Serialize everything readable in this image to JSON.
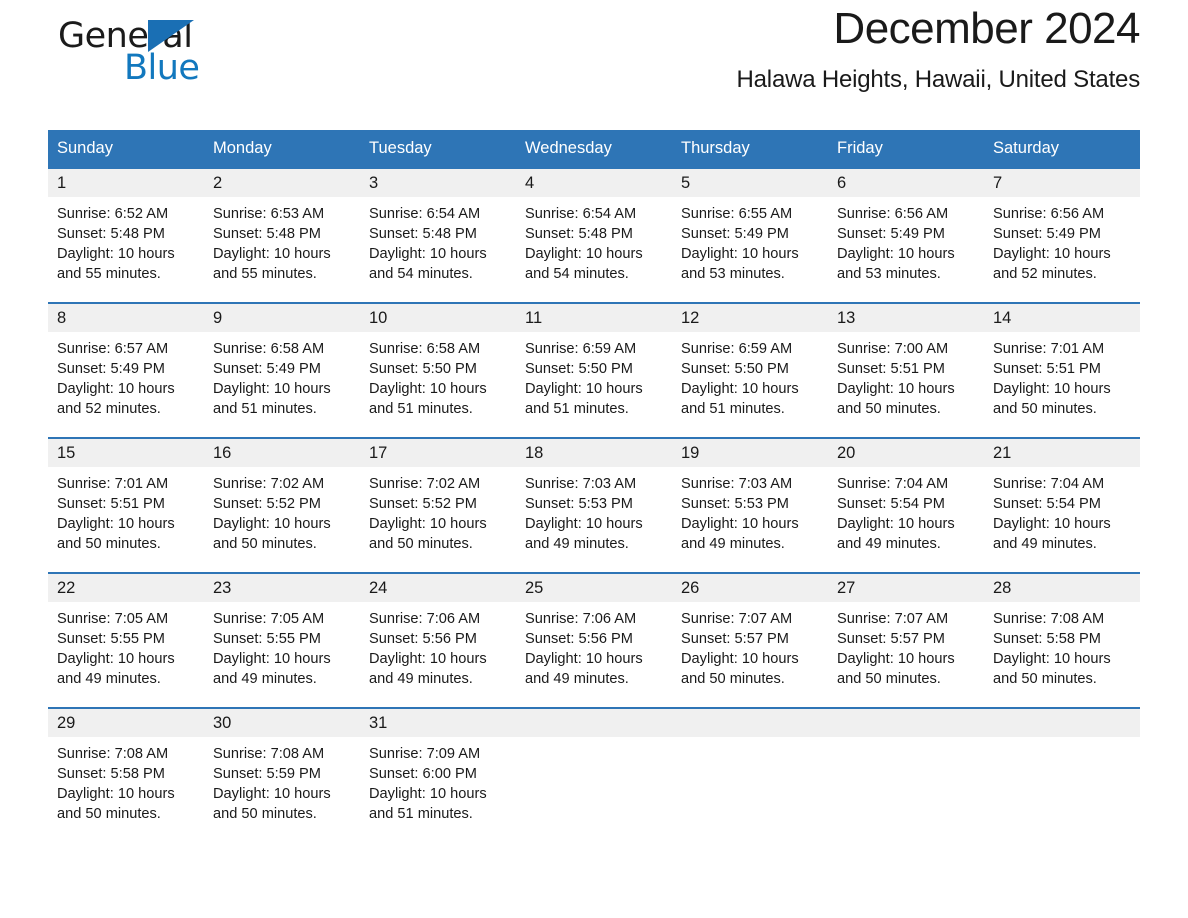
{
  "brand": {
    "name_part1": "General",
    "name_part2": "Blue",
    "triangle_color": "#1a6fb4",
    "blue_text_color": "#1278be"
  },
  "header": {
    "title": "December 2024",
    "subtitle": "Halawa Heights, Hawaii, United States"
  },
  "theme": {
    "header_blue": "#2e75b6",
    "daynum_band": "#f0f0f0",
    "page_background": "#ffffff",
    "text_color": "#1a1a1a"
  },
  "calendar": {
    "weekday_headers": [
      "Sunday",
      "Monday",
      "Tuesday",
      "Wednesday",
      "Thursday",
      "Friday",
      "Saturday"
    ],
    "weeks": [
      [
        {
          "day": "1",
          "sunrise": "Sunrise: 6:52 AM",
          "sunset": "Sunset: 5:48 PM",
          "daylight": "Daylight: 10 hours and 55 minutes."
        },
        {
          "day": "2",
          "sunrise": "Sunrise: 6:53 AM",
          "sunset": "Sunset: 5:48 PM",
          "daylight": "Daylight: 10 hours and 55 minutes."
        },
        {
          "day": "3",
          "sunrise": "Sunrise: 6:54 AM",
          "sunset": "Sunset: 5:48 PM",
          "daylight": "Daylight: 10 hours and 54 minutes."
        },
        {
          "day": "4",
          "sunrise": "Sunrise: 6:54 AM",
          "sunset": "Sunset: 5:48 PM",
          "daylight": "Daylight: 10 hours and 54 minutes."
        },
        {
          "day": "5",
          "sunrise": "Sunrise: 6:55 AM",
          "sunset": "Sunset: 5:49 PM",
          "daylight": "Daylight: 10 hours and 53 minutes."
        },
        {
          "day": "6",
          "sunrise": "Sunrise: 6:56 AM",
          "sunset": "Sunset: 5:49 PM",
          "daylight": "Daylight: 10 hours and 53 minutes."
        },
        {
          "day": "7",
          "sunrise": "Sunrise: 6:56 AM",
          "sunset": "Sunset: 5:49 PM",
          "daylight": "Daylight: 10 hours and 52 minutes."
        }
      ],
      [
        {
          "day": "8",
          "sunrise": "Sunrise: 6:57 AM",
          "sunset": "Sunset: 5:49 PM",
          "daylight": "Daylight: 10 hours and 52 minutes."
        },
        {
          "day": "9",
          "sunrise": "Sunrise: 6:58 AM",
          "sunset": "Sunset: 5:49 PM",
          "daylight": "Daylight: 10 hours and 51 minutes."
        },
        {
          "day": "10",
          "sunrise": "Sunrise: 6:58 AM",
          "sunset": "Sunset: 5:50 PM",
          "daylight": "Daylight: 10 hours and 51 minutes."
        },
        {
          "day": "11",
          "sunrise": "Sunrise: 6:59 AM",
          "sunset": "Sunset: 5:50 PM",
          "daylight": "Daylight: 10 hours and 51 minutes."
        },
        {
          "day": "12",
          "sunrise": "Sunrise: 6:59 AM",
          "sunset": "Sunset: 5:50 PM",
          "daylight": "Daylight: 10 hours and 51 minutes."
        },
        {
          "day": "13",
          "sunrise": "Sunrise: 7:00 AM",
          "sunset": "Sunset: 5:51 PM",
          "daylight": "Daylight: 10 hours and 50 minutes."
        },
        {
          "day": "14",
          "sunrise": "Sunrise: 7:01 AM",
          "sunset": "Sunset: 5:51 PM",
          "daylight": "Daylight: 10 hours and 50 minutes."
        }
      ],
      [
        {
          "day": "15",
          "sunrise": "Sunrise: 7:01 AM",
          "sunset": "Sunset: 5:51 PM",
          "daylight": "Daylight: 10 hours and 50 minutes."
        },
        {
          "day": "16",
          "sunrise": "Sunrise: 7:02 AM",
          "sunset": "Sunset: 5:52 PM",
          "daylight": "Daylight: 10 hours and 50 minutes."
        },
        {
          "day": "17",
          "sunrise": "Sunrise: 7:02 AM",
          "sunset": "Sunset: 5:52 PM",
          "daylight": "Daylight: 10 hours and 50 minutes."
        },
        {
          "day": "18",
          "sunrise": "Sunrise: 7:03 AM",
          "sunset": "Sunset: 5:53 PM",
          "daylight": "Daylight: 10 hours and 49 minutes."
        },
        {
          "day": "19",
          "sunrise": "Sunrise: 7:03 AM",
          "sunset": "Sunset: 5:53 PM",
          "daylight": "Daylight: 10 hours and 49 minutes."
        },
        {
          "day": "20",
          "sunrise": "Sunrise: 7:04 AM",
          "sunset": "Sunset: 5:54 PM",
          "daylight": "Daylight: 10 hours and 49 minutes."
        },
        {
          "day": "21",
          "sunrise": "Sunrise: 7:04 AM",
          "sunset": "Sunset: 5:54 PM",
          "daylight": "Daylight: 10 hours and 49 minutes."
        }
      ],
      [
        {
          "day": "22",
          "sunrise": "Sunrise: 7:05 AM",
          "sunset": "Sunset: 5:55 PM",
          "daylight": "Daylight: 10 hours and 49 minutes."
        },
        {
          "day": "23",
          "sunrise": "Sunrise: 7:05 AM",
          "sunset": "Sunset: 5:55 PM",
          "daylight": "Daylight: 10 hours and 49 minutes."
        },
        {
          "day": "24",
          "sunrise": "Sunrise: 7:06 AM",
          "sunset": "Sunset: 5:56 PM",
          "daylight": "Daylight: 10 hours and 49 minutes."
        },
        {
          "day": "25",
          "sunrise": "Sunrise: 7:06 AM",
          "sunset": "Sunset: 5:56 PM",
          "daylight": "Daylight: 10 hours and 49 minutes."
        },
        {
          "day": "26",
          "sunrise": "Sunrise: 7:07 AM",
          "sunset": "Sunset: 5:57 PM",
          "daylight": "Daylight: 10 hours and 50 minutes."
        },
        {
          "day": "27",
          "sunrise": "Sunrise: 7:07 AM",
          "sunset": "Sunset: 5:57 PM",
          "daylight": "Daylight: 10 hours and 50 minutes."
        },
        {
          "day": "28",
          "sunrise": "Sunrise: 7:08 AM",
          "sunset": "Sunset: 5:58 PM",
          "daylight": "Daylight: 10 hours and 50 minutes."
        }
      ],
      [
        {
          "day": "29",
          "sunrise": "Sunrise: 7:08 AM",
          "sunset": "Sunset: 5:58 PM",
          "daylight": "Daylight: 10 hours and 50 minutes."
        },
        {
          "day": "30",
          "sunrise": "Sunrise: 7:08 AM",
          "sunset": "Sunset: 5:59 PM",
          "daylight": "Daylight: 10 hours and 50 minutes."
        },
        {
          "day": "31",
          "sunrise": "Sunrise: 7:09 AM",
          "sunset": "Sunset: 6:00 PM",
          "daylight": "Daylight: 10 hours and 51 minutes."
        },
        {
          "day": "",
          "sunrise": "",
          "sunset": "",
          "daylight": ""
        },
        {
          "day": "",
          "sunrise": "",
          "sunset": "",
          "daylight": ""
        },
        {
          "day": "",
          "sunrise": "",
          "sunset": "",
          "daylight": ""
        },
        {
          "day": "",
          "sunrise": "",
          "sunset": "",
          "daylight": ""
        }
      ]
    ]
  }
}
